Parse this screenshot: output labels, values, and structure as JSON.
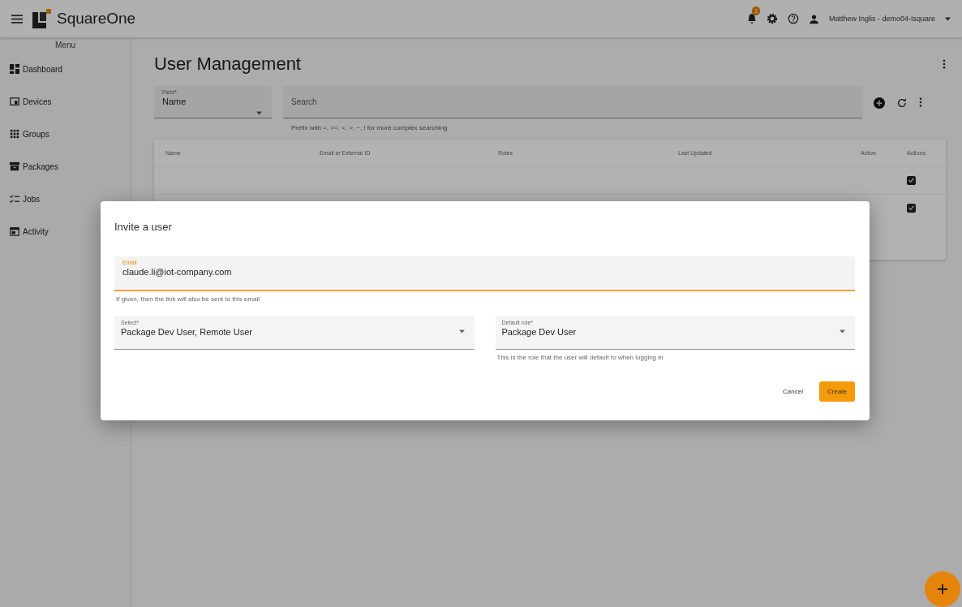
{
  "app_bar": {
    "brand": "SquareOne",
    "notification_badge": "1",
    "user": "Matthew Inglis - demo04-Isquare"
  },
  "sidebar": {
    "title": "Menu",
    "items": [
      {
        "label": "Dashboard"
      },
      {
        "label": "Devices"
      },
      {
        "label": "Groups"
      },
      {
        "label": "Packages"
      },
      {
        "label": "Jobs"
      },
      {
        "label": "Activity"
      }
    ]
  },
  "page": {
    "title": "User Management",
    "field_select": {
      "label": "Field*",
      "value": "Name"
    },
    "search": {
      "placeholder": "Search",
      "hint": "Prefix with =, >=, <, >, ~, ! for more complex searching"
    },
    "table": {
      "columns": [
        "Name",
        "Email or External ID",
        "Roles",
        "Last Updated",
        "Active",
        "Actions"
      ],
      "rows": [
        {
          "checked": true
        },
        {
          "checked": true
        }
      ]
    }
  },
  "dialog": {
    "title": "Invite a user",
    "email": {
      "label": "Email",
      "value": "claude.li@iot-company.com",
      "hint": "If given, then the link will also be sent to this email"
    },
    "roles": {
      "label": "Select*",
      "value": "Package Dev User, Remote User"
    },
    "default_role": {
      "label": "Default role*",
      "value": "Package Dev User",
      "hint": "This is the role that the user will default to when logging in"
    },
    "buttons": [
      {
        "label": "Cancel",
        "kind": "text"
      },
      {
        "label": "Create",
        "kind": "primary"
      }
    ]
  }
}
